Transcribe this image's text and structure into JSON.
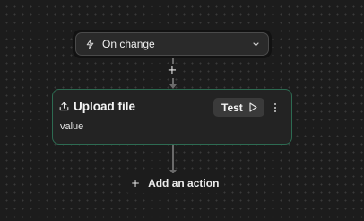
{
  "trigger": {
    "label": "On change",
    "icon": "bolt-icon"
  },
  "connector": {
    "plus_symbol": "+"
  },
  "action_card": {
    "title": "Upload file",
    "icon": "upload-icon",
    "value": "value",
    "test_label": "Test",
    "border_color": "#2d6b52"
  },
  "add_action": {
    "plus_symbol": "+",
    "label": "Add an action"
  }
}
